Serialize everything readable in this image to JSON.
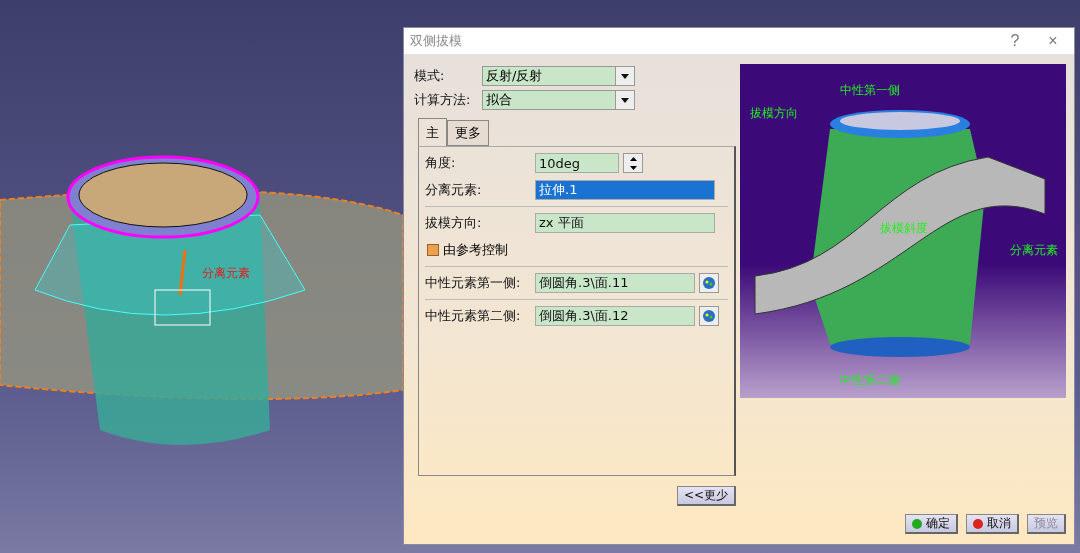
{
  "viewport": {
    "label": "分离元素"
  },
  "dialog": {
    "title": "双侧拔模",
    "help": "?",
    "close": "×",
    "fields": [
      {
        "label": "模式:",
        "value": "反射/反射"
      },
      {
        "label": "计算方法:",
        "value": "拟合"
      }
    ],
    "tabs": [
      {
        "label": "主",
        "selected": true
      },
      {
        "label": "更多",
        "selected": false
      }
    ],
    "angle": {
      "label": "角度:",
      "value": "10deg"
    },
    "separating": {
      "label": "分离元素:",
      "value": "拉伸.1",
      "selected": true
    },
    "direction": {
      "label": "拔模方向:",
      "value": "zx 平面",
      "selected": false
    },
    "controlled": {
      "label": "由参考控制",
      "checked": false
    },
    "neutral": [
      {
        "label": "中性元素第一侧:",
        "value": "倒圆角.3\\面.11"
      },
      {
        "label": "中性元素第二侧:",
        "value": "倒圆角.3\\面.12"
      }
    ],
    "less_button": "<<更少",
    "preview_labels": [
      "中性第一侧",
      "拔模方向",
      "拔模斜度",
      "分离元素",
      "中性第二侧"
    ],
    "buttons": [
      {
        "label": "确定",
        "kind": "ok",
        "disabled": false
      },
      {
        "label": "取消",
        "kind": "cancel",
        "disabled": false
      },
      {
        "label": "预览",
        "kind": "plain",
        "disabled": true
      }
    ]
  }
}
